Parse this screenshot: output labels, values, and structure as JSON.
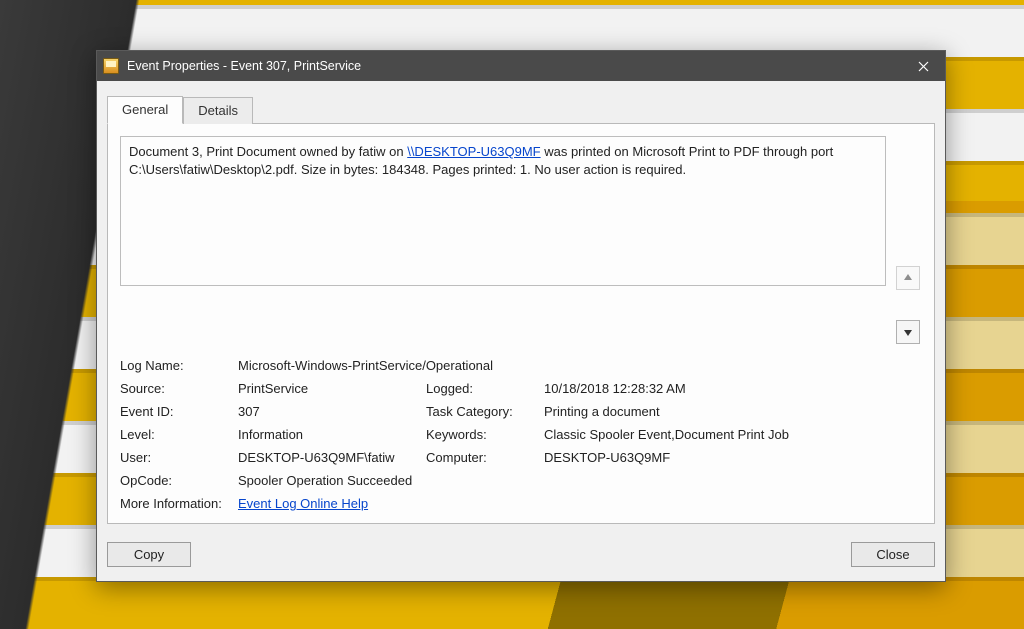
{
  "window": {
    "title": "Event Properties - Event 307, PrintService"
  },
  "tabs": {
    "general": "General",
    "details": "Details"
  },
  "description": {
    "pre": "Document 3, Print Document owned by fatiw on ",
    "link": "\\\\DESKTOP-U63Q9MF",
    "post": " was printed on Microsoft Print to PDF through port C:\\Users\\fatiw\\Desktop\\2.pdf.  Size in bytes: 184348. Pages printed: 1. No user action is required."
  },
  "fields": {
    "log_name_label": "Log Name:",
    "log_name": "Microsoft-Windows-PrintService/Operational",
    "source_label": "Source:",
    "source": "PrintService",
    "logged_label": "Logged:",
    "logged": "10/18/2018 12:28:32 AM",
    "event_id_label": "Event ID:",
    "event_id": "307",
    "task_category_label": "Task Category:",
    "task_category": "Printing a document",
    "level_label": "Level:",
    "level": "Information",
    "keywords_label": "Keywords:",
    "keywords": "Classic Spooler Event,Document Print Job",
    "user_label": "User:",
    "user": "DESKTOP-U63Q9MF\\fatiw",
    "computer_label": "Computer:",
    "computer": "DESKTOP-U63Q9MF",
    "opcode_label": "OpCode:",
    "opcode": "Spooler Operation Succeeded",
    "more_info_label": "More Information:",
    "more_info_link": "Event Log Online Help"
  },
  "buttons": {
    "copy": "Copy",
    "close": "Close"
  }
}
